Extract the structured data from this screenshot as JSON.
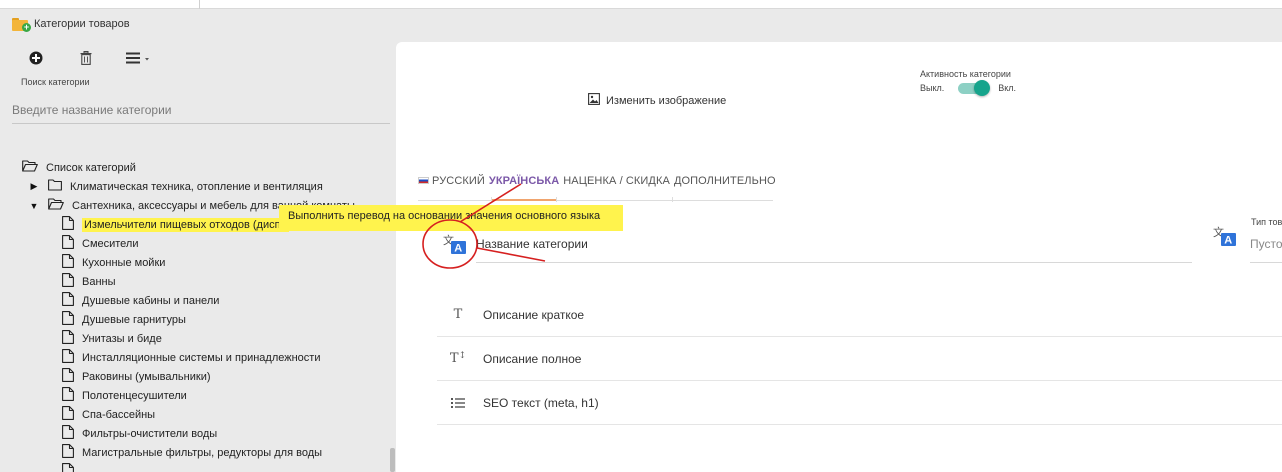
{
  "window": {
    "title": "Категории товаров"
  },
  "toolbar": {
    "add": "add-circle",
    "delete": "trash",
    "menu": "hamburger-dropdown"
  },
  "search": {
    "label": "Поиск категории",
    "placeholder": "Введите название категории"
  },
  "tree": {
    "root_label": "Список категорий",
    "items": [
      {
        "label": "Климатическая техника, отопление и вентиляция",
        "expanded": false
      },
      {
        "label": "Сантехника, аксессуары и мебель для ванной комнаты",
        "expanded": true
      }
    ],
    "children": [
      "Измельчители пищевых отходов (диспо",
      "Смесители",
      "Кухонные мойки",
      "Ванны",
      "Душевые кабины и панели",
      "Душевые гарнитуры",
      "Унитазы и биде",
      "Инсталляционные системы и принадлежности",
      "Раковины (умывальники)",
      "Полотенцесушители",
      "Спа-бассейны",
      "Фильтры-очистители воды",
      "Магистральные фильтры, редукторы для воды"
    ],
    "highlight_color": "#fff34d"
  },
  "panel": {
    "change_image": "Изменить изображение",
    "activity": {
      "label": "Активность категории",
      "off": "Выкл.",
      "on": "Вкл.",
      "enabled": true,
      "color": "#16a48c"
    },
    "tabs": [
      "РУССКИЙ",
      "УКРАЇНСЬКА",
      "НАЦЕНКА / СКИДКА",
      "ДОПОЛНИТЕЛЬНО"
    ],
    "active_tab": "УКРАЇНСЬКА",
    "accent_color": "#7b58a8",
    "name_placeholder": "Название категории",
    "type_label": "Тип тов",
    "type_placeholder": "Пусто",
    "sections": [
      {
        "label": "Описание краткое",
        "icon": "text-icon"
      },
      {
        "label": "Описание полное",
        "icon": "text-height-icon"
      },
      {
        "label": "SEO текст (meta, h1)",
        "icon": "list-icon"
      }
    ]
  },
  "tooltip": {
    "text": "Выполнить перевод на основании значения основного языка",
    "color": "#fff34d"
  },
  "annotation_color": "#d62020"
}
